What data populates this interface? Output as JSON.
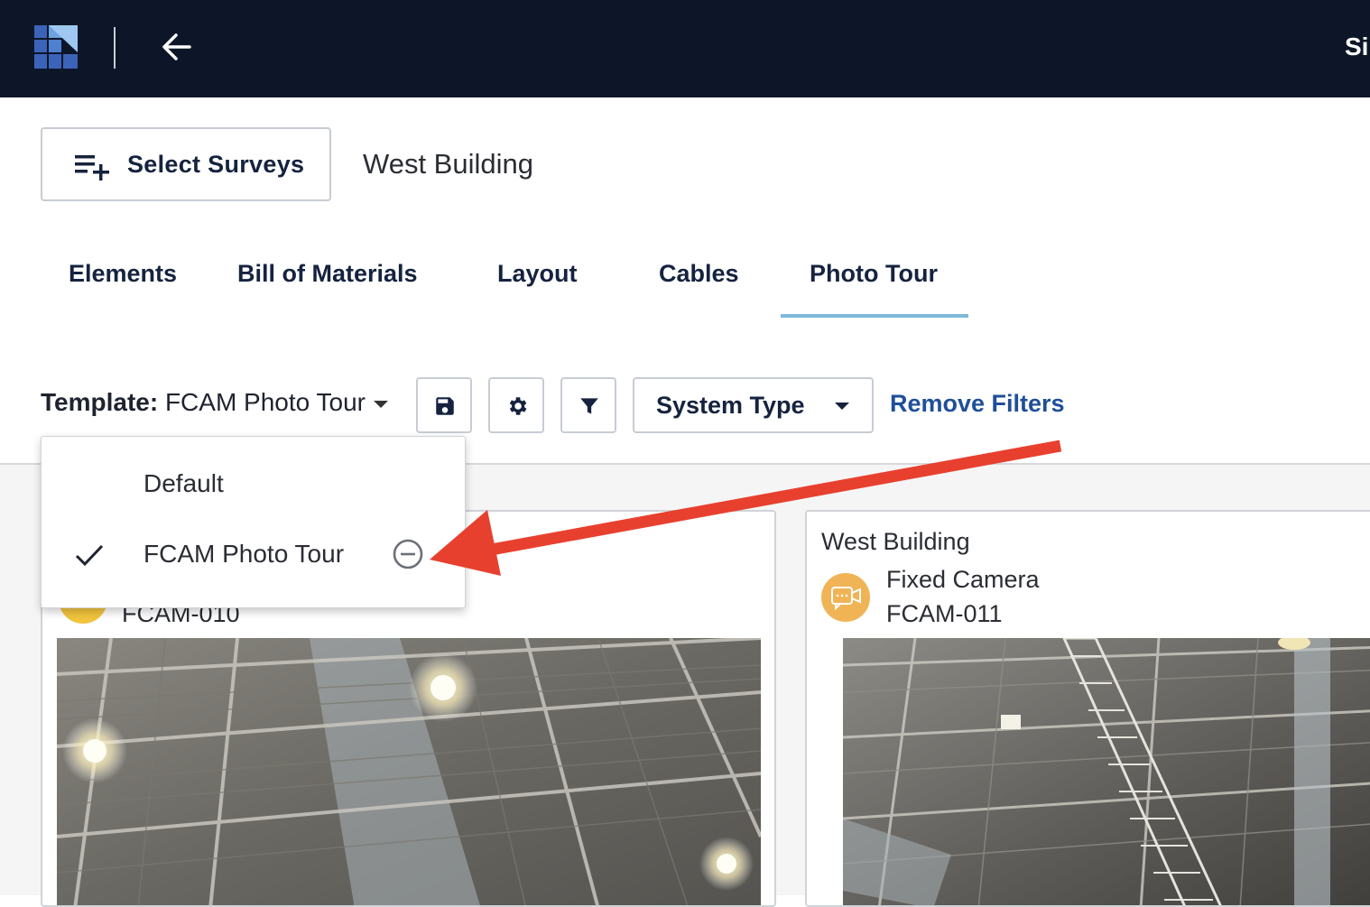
{
  "header": {
    "logo_icon": "app-logo-icon",
    "back_icon": "arrow-left-icon",
    "right_text": "Si"
  },
  "toolbar": {
    "select_surveys_label": "Select Surveys",
    "select_surveys_icon": "playlist-add-icon",
    "survey_name": "West Building"
  },
  "tabs": [
    {
      "label": "Elements"
    },
    {
      "label": "Bill of Materials"
    },
    {
      "label": "Layout"
    },
    {
      "label": "Cables"
    },
    {
      "label": "Photo Tour",
      "active": true
    }
  ],
  "filters": {
    "template_prefix": "Template:",
    "template_value": "FCAM Photo Tour",
    "save_icon": "save-icon",
    "settings_icon": "gear-icon",
    "filter_icon": "filter-icon",
    "system_type_label": "System Type",
    "remove_filters_label": "Remove Filters"
  },
  "template_menu": {
    "items": [
      {
        "label": "Default",
        "selected": false
      },
      {
        "label": "FCAM Photo Tour",
        "selected": true,
        "removable": true
      }
    ]
  },
  "cards": [
    {
      "title": "",
      "type": "",
      "id": "FCAM-010"
    },
    {
      "title": "West Building",
      "type": "Fixed Camera",
      "id": "FCAM-011"
    }
  ],
  "colors": {
    "header_bg": "#0c1628",
    "primary_text": "#15233f",
    "link": "#1f4f9a",
    "tab_indicator": "#7fb8d9",
    "camera_badge": "#f0b456",
    "annotation_arrow": "#e8402f"
  }
}
